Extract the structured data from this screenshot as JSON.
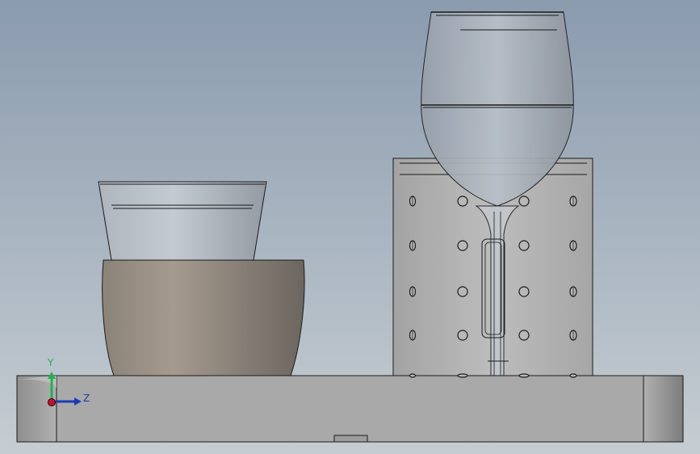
{
  "viewport": {
    "background_top": "#8a9bae",
    "background_bottom": "#c6cdd2"
  },
  "triad": {
    "y_label": "Y",
    "z_label": "Z",
    "y_color": "#22b14c",
    "z_color": "#1a3cb4",
    "x_color": "#c8102e"
  },
  "colors": {
    "edge": "#1a1a1a",
    "base_plate": "#a8a8a8",
    "bowl_light": "#a59a8e",
    "bowl_dark": "#6c6660",
    "glass_light": "#c2c8cf",
    "glass_dark": "#939aa2",
    "cylinder": "#b5b5b5"
  }
}
